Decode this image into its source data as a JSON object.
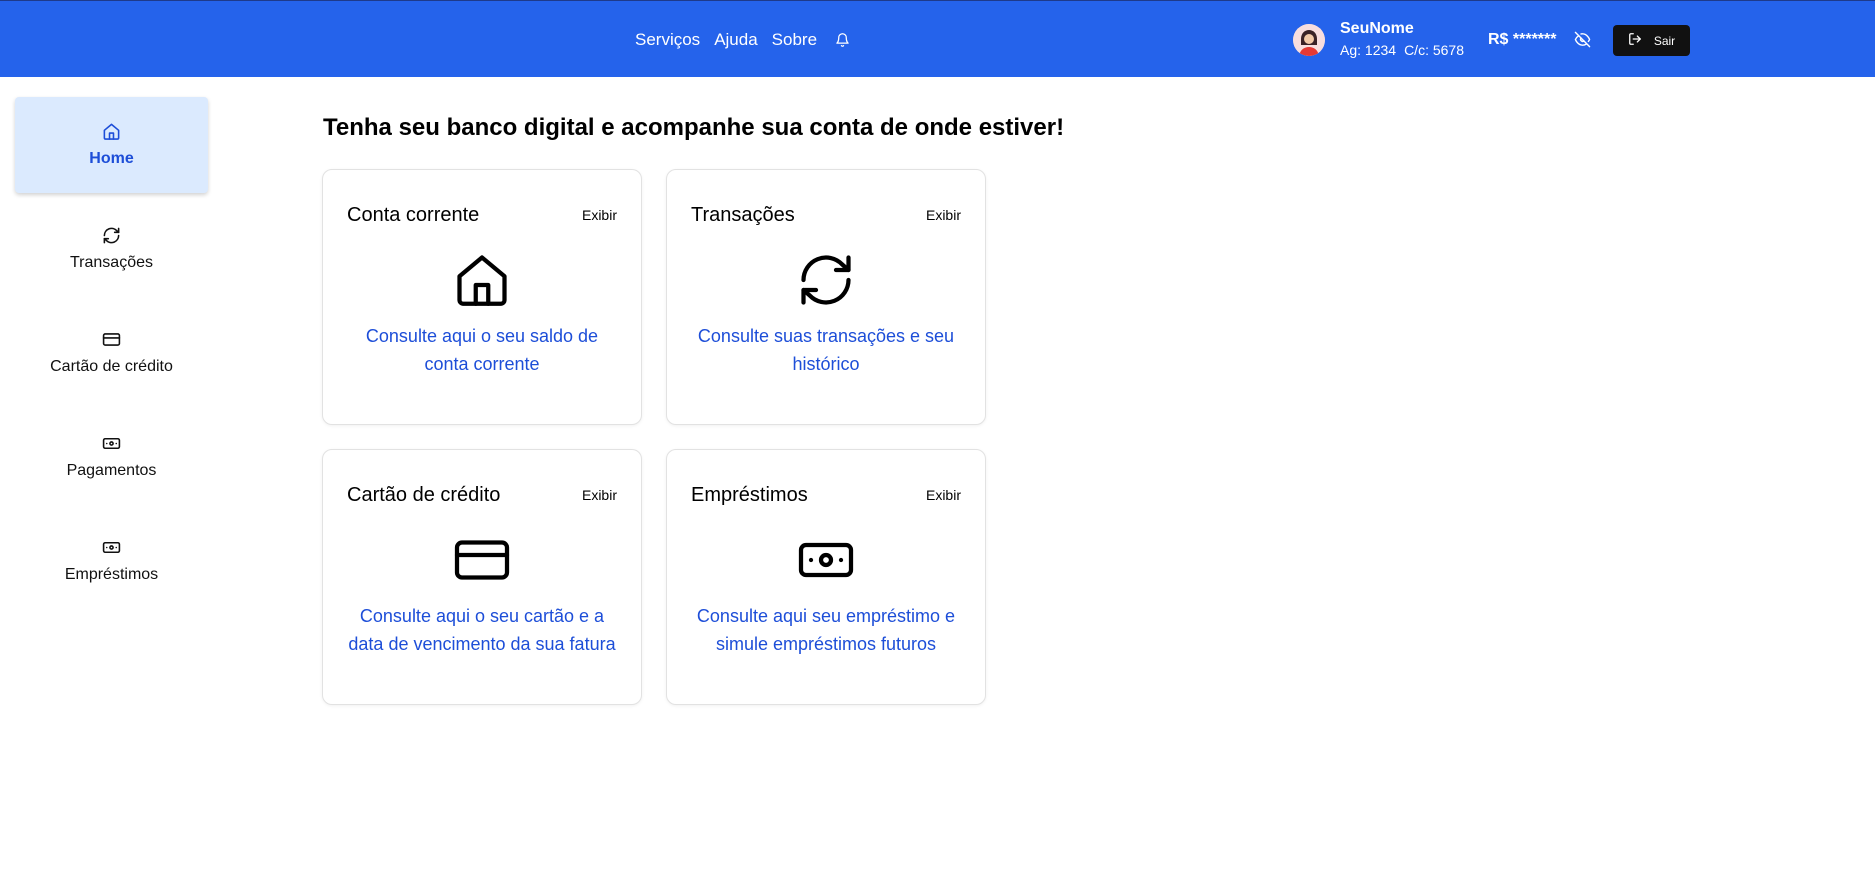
{
  "header": {
    "nav": [
      "Serviços",
      "Ajuda",
      "Sobre"
    ],
    "user_name": "SeuNome",
    "agency": "Ag: 1234",
    "account": "C/c: 5678",
    "balance": "R$ *******",
    "logout_label": "Sair"
  },
  "sidebar": {
    "items": [
      {
        "label": "Home",
        "icon": "home-icon"
      },
      {
        "label": "Transações",
        "icon": "refresh-icon"
      },
      {
        "label": "Cartão de crédito",
        "icon": "credit-card-icon"
      },
      {
        "label": "Pagamentos",
        "icon": "banknote-icon"
      },
      {
        "label": "Empréstimos",
        "icon": "banknote-icon"
      }
    ]
  },
  "main": {
    "title": "Tenha seu banco digital e acompanhe sua conta de onde estiver!",
    "cards": [
      {
        "title": "Conta corrente",
        "link": "Exibir",
        "desc_1": "Consulte aqui o seu saldo de",
        "desc_2": "conta corrente",
        "icon": "home-icon"
      },
      {
        "title": "Transações",
        "link": "Exibir",
        "desc_1": "Consulte suas transações e seu",
        "desc_2": "histórico",
        "icon": "refresh-icon"
      },
      {
        "title": "Cartão de crédito",
        "link": "Exibir",
        "desc_1": "Consulte aqui o seu cartão e a",
        "desc_2": "data de vencimento da sua fatura",
        "icon": "credit-card-icon"
      },
      {
        "title": "Empréstimos",
        "link": "Exibir",
        "desc_1": "Consulte aqui seu empréstimo e",
        "desc_2": "simule empréstimos futuros",
        "icon": "banknote-icon"
      }
    ]
  },
  "colors": {
    "header_bg": "#2563eb",
    "accent": "#1d4ed8",
    "active_bg": "#dbeafe",
    "button_dark": "#111111"
  }
}
